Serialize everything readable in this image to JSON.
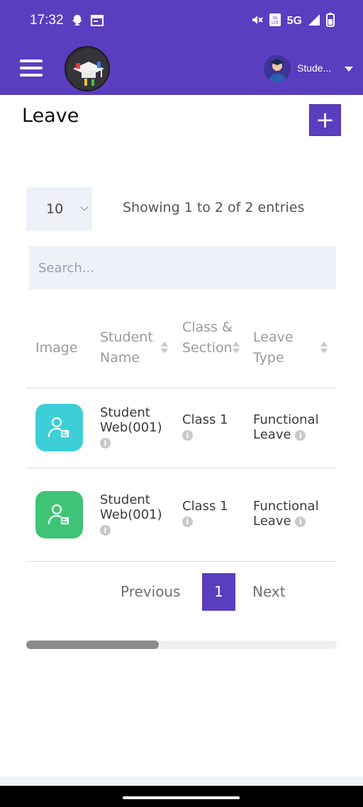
{
  "status_bar": {
    "time": "17:32",
    "network": "5G",
    "icons": [
      "snapchat-icon",
      "calendar-icon",
      "mute-icon",
      "volte-icon",
      "signal-icon",
      "battery-icon"
    ]
  },
  "app_bar": {
    "background": "#5a3ec0",
    "user_name": "Stude...",
    "icons": [
      "menu-icon",
      "app-logo",
      "user-avatar",
      "caret-down-icon"
    ]
  },
  "page": {
    "title": "Leave",
    "add_button": "+"
  },
  "table_controls": {
    "page_length": "10",
    "entries_info": "Showing 1 to 2 of 2 entries",
    "search_placeholder": "Search..."
  },
  "table": {
    "columns": {
      "image": "Image",
      "student_name": "Student Name",
      "class_section": "Class & Section",
      "leave_type": "Leave Type"
    },
    "rows": [
      {
        "student_name": "Student Web(001)",
        "class_section": "Class 1",
        "leave_type": "Functional Leave",
        "image_color": "#3ccfd8"
      },
      {
        "student_name": "Student Web(001)",
        "class_section": "Class 1",
        "leave_type": "Functional Leave",
        "image_color": "#3ec476"
      }
    ]
  },
  "pagination": {
    "previous": "Previous",
    "current": "1",
    "next": "Next"
  },
  "scroll": {
    "horizontal_position": 0.0
  }
}
